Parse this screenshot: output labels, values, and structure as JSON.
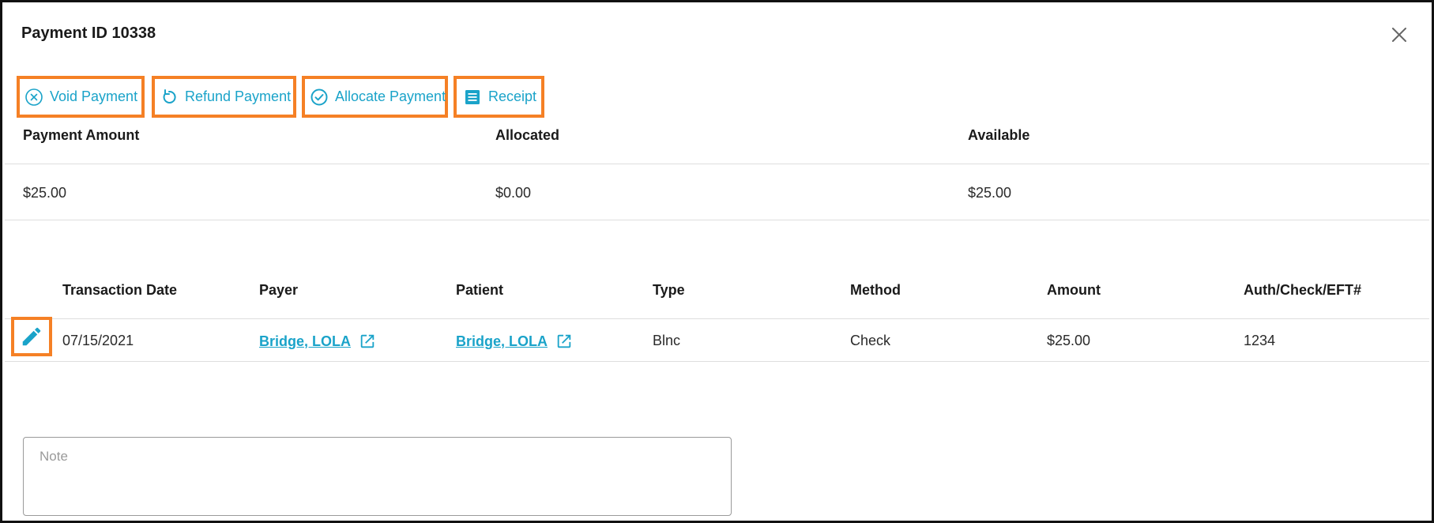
{
  "dialog": {
    "title": "Payment ID 10338",
    "close_icon": "close-icon"
  },
  "actions": {
    "void": {
      "label": "Void Payment",
      "icon": "cancel-circle-icon"
    },
    "refund": {
      "label": "Refund Payment",
      "icon": "refresh-icon"
    },
    "allocate": {
      "label": "Allocate Payment",
      "icon": "check-circle-icon"
    },
    "receipt": {
      "label": "Receipt",
      "icon": "receipt-icon"
    }
  },
  "summary": {
    "headers": [
      "Payment Amount",
      "Allocated",
      "Available"
    ],
    "values": [
      "$25.00",
      "$0.00",
      "$25.00"
    ]
  },
  "transactions": {
    "headers": [
      "Transaction Date",
      "Payer",
      "Patient",
      "Type",
      "Method",
      "Amount",
      "Auth/Check/EFT#"
    ],
    "rows": [
      {
        "date": "07/15/2021",
        "payer": "Bridge, LOLA",
        "patient": "Bridge, LOLA",
        "type": "Blnc",
        "method": "Check",
        "amount": "$25.00",
        "auth": "1234"
      }
    ]
  },
  "note": {
    "placeholder": "Note",
    "value": ""
  },
  "colors": {
    "accent": "#1aa3c9",
    "highlight": "#f58025"
  }
}
